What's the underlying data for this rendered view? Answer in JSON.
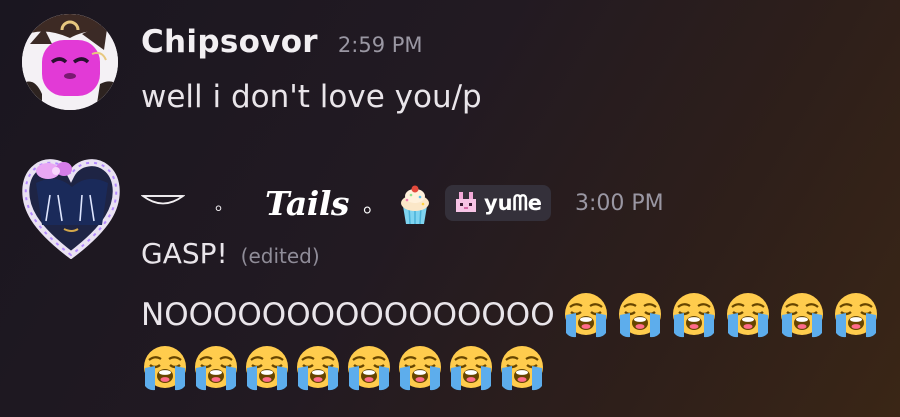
{
  "messages": [
    {
      "username": "Chipsovor",
      "timestamp": "2:59 PM",
      "lines": [
        "well i don't love you/p"
      ]
    },
    {
      "nickname": {
        "dot1": "。",
        "name": "Tails",
        "dot2": "。"
      },
      "clan_tag": "yuᗰe",
      "timestamp": "3:00 PM",
      "line1": "GASP!",
      "edited_label": "(edited)",
      "line2": "NOOOOOOOOOOOOOOOO",
      "emoji_name": "loudly-crying-face",
      "emoji_count_line1": 6,
      "emoji_count_line2": 8
    }
  ],
  "colors": {
    "username": "#f2eff2",
    "timestamp": "#9a97a3",
    "text": "#e9e5ea",
    "edited": "#8f8c98",
    "clan_tag_bg": "#34303a",
    "avatar1_accent": "#e23ad6",
    "avatar2_frame": "#c9a8ff"
  }
}
